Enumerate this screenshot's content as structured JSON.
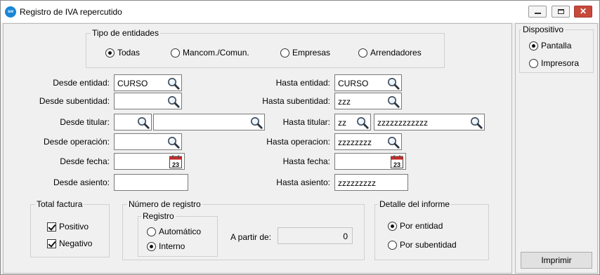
{
  "window": {
    "title": "Registro de IVA repercutido",
    "app_icon_text": "sw"
  },
  "tipo": {
    "legend": "Tipo de entidades",
    "options": [
      "Todas",
      "Mancom./Comun.",
      "Empresas",
      "Arrendadores"
    ],
    "selected": "Todas"
  },
  "labels": {
    "desde_entidad": "Desde entidad:",
    "hasta_entidad": "Hasta entidad:",
    "desde_subentidad": "Desde subentidad:",
    "hasta_subentidad": "Hasta subentidad:",
    "desde_titular": "Desde titular:",
    "hasta_titular": "Hasta titular:",
    "desde_operacion": "Desde operación:",
    "hasta_operacion": "Hasta operacion:",
    "desde_fecha": "Desde fecha:",
    "hasta_fecha": "Hasta fecha:",
    "desde_asiento": "Desde asiento:",
    "hasta_asiento": "Hasta asiento:"
  },
  "values": {
    "desde_entidad": "CURSO",
    "hasta_entidad": "CURSO",
    "desde_subentidad": "",
    "hasta_subentidad": "zzz",
    "desde_titular_code": "",
    "desde_titular_name": "",
    "hasta_titular_code": "zz",
    "hasta_titular_name": "zzzzzzzzzzzz",
    "desde_operacion": "",
    "hasta_operacion": "zzzzzzzz",
    "desde_fecha": "",
    "hasta_fecha": "",
    "desde_asiento": "",
    "hasta_asiento": "zzzzzzzzz"
  },
  "calendar_glyph": "23",
  "total_factura": {
    "legend": "Total factura",
    "positivo": {
      "label": "Positivo",
      "checked": true
    },
    "negativo": {
      "label": "Negativo",
      "checked": true
    }
  },
  "numero_registro": {
    "legend": "Número de registro",
    "registro_legend": "Registro",
    "options": [
      "Automático",
      "Interno"
    ],
    "selected": "Interno",
    "a_partir_label": "A partir de:",
    "a_partir_value": "0"
  },
  "detalle": {
    "legend": "Detalle del informe",
    "options": [
      "Por entidad",
      "Por subentidad"
    ],
    "selected": "Por entidad"
  },
  "dispositivo": {
    "legend": "Dispositivo",
    "options": [
      "Pantalla",
      "Impresora"
    ],
    "selected": "Pantalla"
  },
  "imprimir_label": "Imprimir",
  "icons": {
    "app": "app-logo-icon",
    "lookup": "magnifier-icon",
    "calendar": "calendar-icon"
  },
  "colors": {
    "app_icon": "#1a86d6",
    "close_button": "#c7493a",
    "panel_bg": "#f0f0f0"
  }
}
